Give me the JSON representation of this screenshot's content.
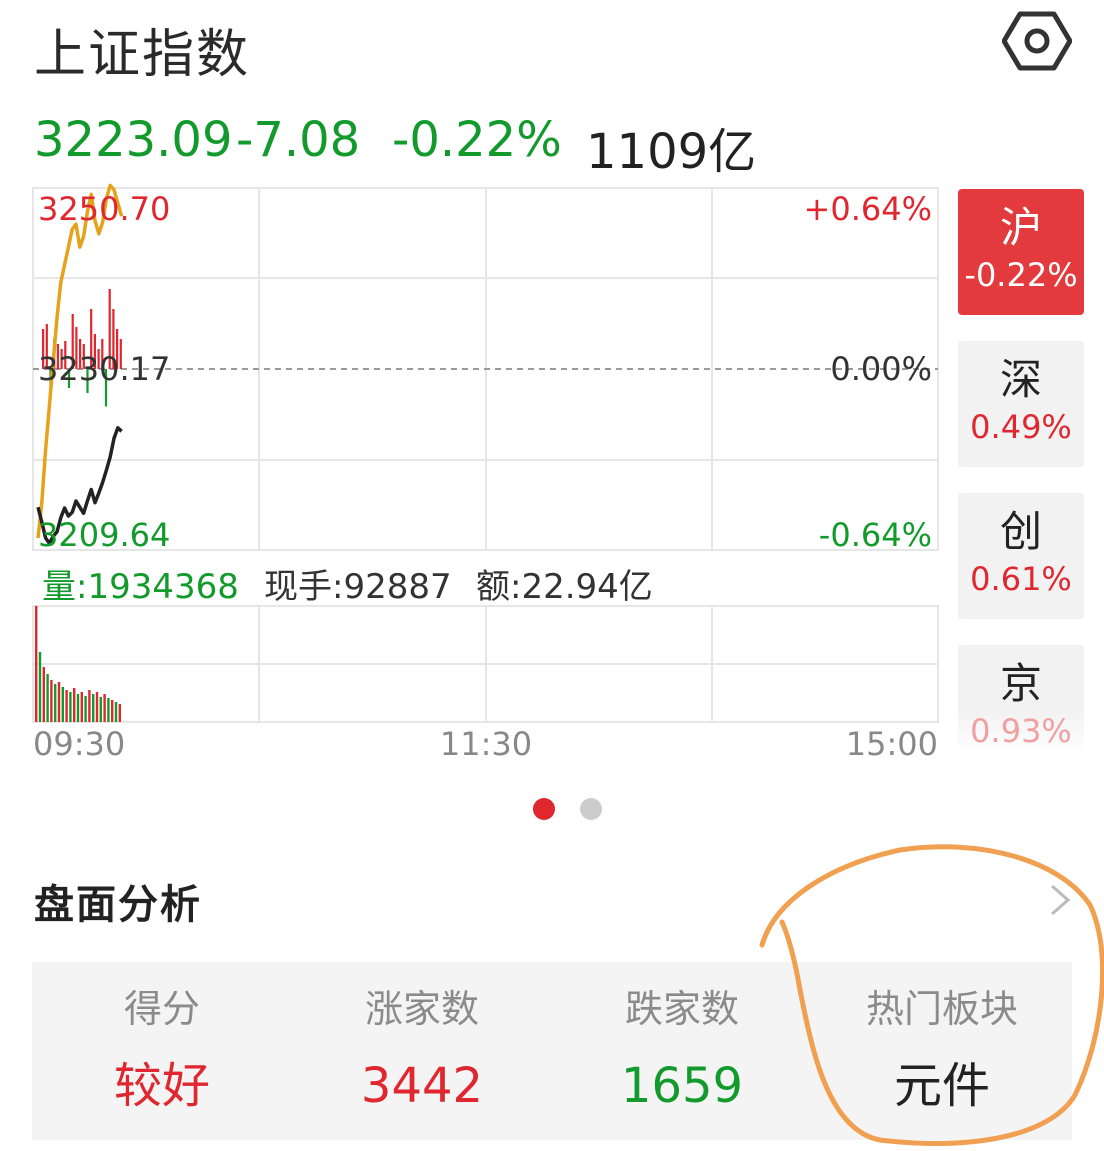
{
  "header": {
    "title": "上证指数",
    "settings_icon": "settings-hexagon-icon"
  },
  "quote": {
    "price": "3223.09",
    "change": "-7.08",
    "change_pct": "-0.22%",
    "turnover": "1109亿"
  },
  "intraday_chart": {
    "y_high_label": "3250.70",
    "y_mid_label": "3230.17",
    "y_low_label": "3209.64",
    "pct_high_label": "+0.64%",
    "pct_mid_label": "0.00%",
    "pct_low_label": "-0.64%",
    "volume_label": "量:1934368",
    "current_hand_label": "现手:92887",
    "amount_label": "额:22.94亿",
    "time_labels": [
      "09:30",
      "11:30",
      "15:00"
    ],
    "colors": {
      "price_line": "#222222",
      "avg_line": "#e5a21b",
      "up": "#e0262e",
      "down": "#139a2c"
    }
  },
  "chart_data": {
    "type": "line",
    "title": "",
    "ylim": [
      3209.64,
      3250.7
    ],
    "yticks": [
      "3250.70",
      "3230.17",
      "3209.64"
    ],
    "xticks": [
      "09:30",
      "11:30",
      "15:00"
    ],
    "series": [
      {
        "values": [
          3214.5,
          3212.8,
          3211.0,
          3210.4,
          3211.2,
          3211.7,
          3213.3,
          3214.4,
          3213.5,
          3213.9,
          3215.2,
          3214.5,
          3213.8,
          3215.2,
          3216.5,
          3215.0,
          3216.1,
          3217.3,
          3218.7,
          3220.2,
          3222.3,
          3223.5,
          3223.1
        ]
      },
      {
        "values": [
          3211.0,
          3215.0,
          3221.0,
          3226.0,
          3231.0,
          3236.0,
          3240.0,
          3242.0,
          3244.0,
          3246.0,
          3246.6,
          3244.0,
          3245.2,
          3248.0,
          3250.0,
          3247.0,
          3245.5,
          3246.8,
          3249.5,
          3251.0,
          3250.5,
          3249.0,
          3247.5
        ]
      }
    ]
  },
  "pager": {
    "colors": {
      "active": "#e0262e",
      "idle": "#cccccc"
    }
  },
  "side_tabs": [
    {
      "name": "沪",
      "pct": "-0.22%"
    },
    {
      "name": "深",
      "pct": "0.49%"
    },
    {
      "name": "创",
      "pct": "0.61%"
    },
    {
      "name": "京",
      "pct": "0.93%"
    }
  ],
  "analysis": {
    "title": "盘面分析",
    "chevron_icon": "chevron-right-icon",
    "cells": [
      {
        "label": "得分",
        "value": "较好"
      },
      {
        "label": "涨家数",
        "value": "3442"
      },
      {
        "label": "跌家数",
        "value": "1659"
      },
      {
        "label": "热门板块",
        "value": "元件"
      }
    ]
  }
}
